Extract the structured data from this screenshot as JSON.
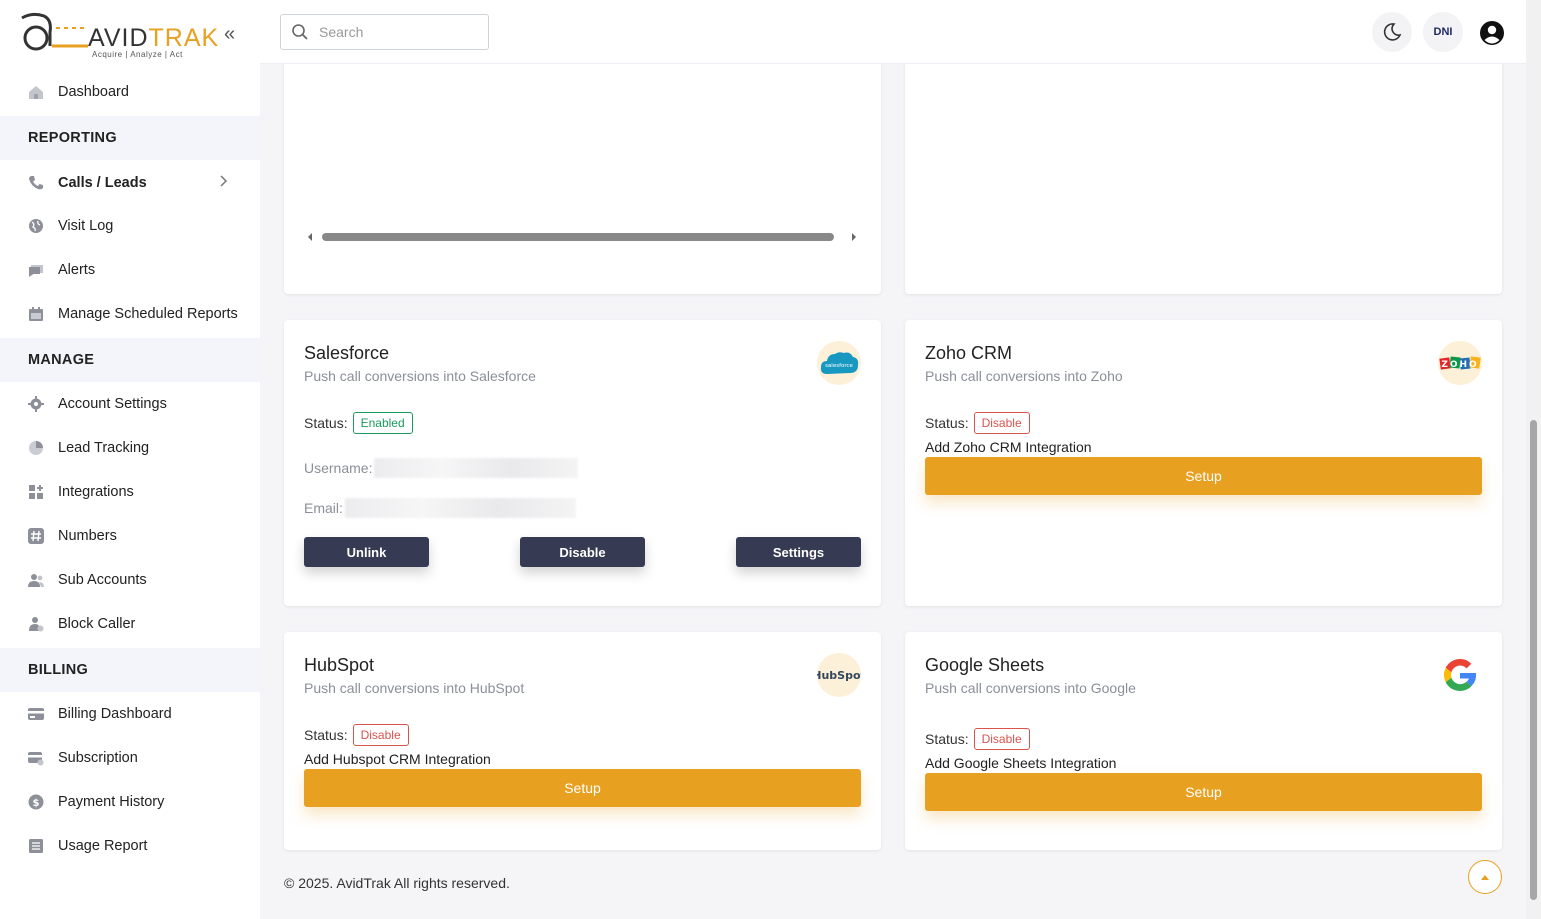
{
  "brand": {
    "name_part1": "AVID",
    "name_part2": "TRAK",
    "tagline": "Acquire  |  Analyze  |  Act"
  },
  "sidebar": {
    "dashboard": "Dashboard",
    "sections": {
      "reporting": "REPORTING",
      "manage": "MANAGE",
      "billing": "BILLING"
    },
    "reporting_items": [
      "Calls / Leads",
      "Visit Log",
      "Alerts",
      "Manage Scheduled Reports"
    ],
    "manage_items": [
      "Account Settings",
      "Lead Tracking",
      "Integrations",
      "Numbers",
      "Sub Accounts",
      "Block Caller"
    ],
    "billing_items": [
      "Billing Dashboard",
      "Subscription",
      "Payment History",
      "Usage Report"
    ]
  },
  "header": {
    "search_placeholder": "Search",
    "profile_badge": "DNI"
  },
  "integrations": {
    "salesforce": {
      "title": "Salesforce",
      "subtitle": "Push call conversions into Salesforce",
      "status_label": "Status:",
      "status": "Enabled",
      "username_label": "Username:",
      "email_label": "Email:",
      "buttons": [
        "Unlink",
        "Disable",
        "Settings"
      ],
      "logo_text": "salesforce"
    },
    "zoho": {
      "title": "Zoho CRM",
      "subtitle": "Push call conversions into Zoho",
      "status_label": "Status:",
      "status": "Disable",
      "add_text": "Add Zoho CRM Integration",
      "button": "Setup",
      "logo_text": "ZOHO"
    },
    "hubspot": {
      "title": "HubSpot",
      "subtitle": "Push call conversions into HubSpot",
      "status_label": "Status:",
      "status": "Disable",
      "add_text": "Add Hubspot CRM Integration",
      "button": "Setup",
      "logo_text": "HubSpot"
    },
    "google_sheets": {
      "title": "Google Sheets",
      "subtitle": "Push call conversions into Google",
      "status_label": "Status:",
      "status": "Disable",
      "add_text": "Add Google Sheets Integration",
      "button": "Setup"
    }
  },
  "footer": {
    "copyright": "© 2025. AvidTrak All rights reserved."
  },
  "colors": {
    "accent": "#e8a020",
    "dark_button": "#363a52",
    "enabled": "#1a9a5c",
    "disabled": "#d9534f"
  }
}
